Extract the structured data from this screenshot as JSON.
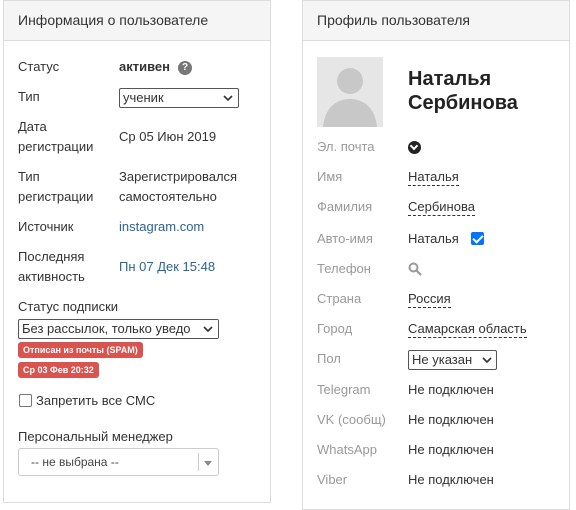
{
  "user_info": {
    "title": "Информация о пользователе",
    "status_label": "Статус",
    "status_value": "активен",
    "type_label": "Тип",
    "type_value": "ученик",
    "reg_date_label_1": "Дата",
    "reg_date_label_2": "регистрации",
    "reg_date_value": "Ср 05 Июн 2019",
    "reg_type_label_1": "Тип",
    "reg_type_label_2": "регистрации",
    "reg_type_value_1": "Зарегистрировался",
    "reg_type_value_2": "самостоятельно",
    "source_label": "Источник",
    "source_value": "instagram.com",
    "last_activity_label_1": "Последняя",
    "last_activity_label_2": "активность",
    "last_activity_value": "Пн 07 Дек 15:48",
    "subscription_label": "Статус подписки",
    "subscription_value": "Без рассылок, только уведо",
    "badge_unsubscribed": "Отписан из почты (SPAM)",
    "badge_date": "Ср 03 Фев 20:32",
    "sms_block_label": "Запретить все СМС",
    "sms_block_checked": false,
    "manager_label": "Персональный менеджер",
    "manager_value": "-- не выбрана --"
  },
  "profile": {
    "title": "Профиль пользователя",
    "name_line_1": "Наталья",
    "name_line_2": "Сербинова",
    "email_label": "Эл. почта",
    "first_name_label": "Имя",
    "first_name_value": "Наталья",
    "last_name_label": "Фамилия",
    "last_name_value": "Сербинова",
    "auto_name_label": "Авто-имя",
    "auto_name_value": "Наталья",
    "auto_name_checked": true,
    "phone_label": "Телефон",
    "country_label": "Страна",
    "country_value": "Россия",
    "city_label": "Город",
    "city_value": "Самарская область",
    "gender_label": "Пол",
    "gender_value": "Не указан",
    "telegram_label": "Telegram",
    "telegram_value": "Не подключен",
    "vk_label": "VK (сообщ)",
    "vk_value": "Не подключен",
    "whatsapp_label": "WhatsApp",
    "whatsapp_value": "Не подключен",
    "viber_label": "Viber",
    "viber_value": "Не подключен"
  },
  "colors": {
    "badge": "#d9534f",
    "link": "#2a6496",
    "checkbox": "#0075ff"
  }
}
